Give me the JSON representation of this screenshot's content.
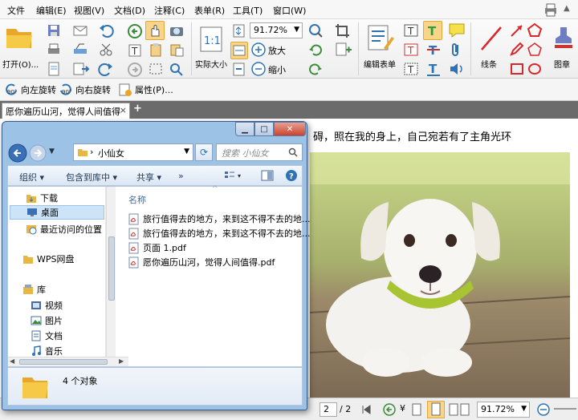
{
  "menu": [
    "文件",
    "编辑(E)",
    "视图(V)",
    "文档(D)",
    "注释(C)",
    "表单(R)",
    "工具(T)",
    "窗口(W)"
  ],
  "ribbon": {
    "open_label": "打开(O)...",
    "actual_size_label": "实际大小",
    "zoom_value": "91.72%",
    "zoom_in_label": "放大",
    "zoom_out_label": "缩小",
    "edit_form_label": "编辑表单",
    "lines_label": "线条",
    "shapes_label": "图章"
  },
  "subbar": {
    "rotate_left": "向左旋转",
    "rotate_right": "向右旋转",
    "properties": "属性(P)..."
  },
  "doc_tab": {
    "title": "愿你遍历山河，觉得人间值得",
    "close": "×",
    "add": "+"
  },
  "doc_text": "碍，照在我的身上，自己宛若有了主角光环",
  "explorer": {
    "address": "小仙女",
    "search_placeholder": "搜索 小仙女",
    "commands": [
      "组织 ▾",
      "包含到库中 ▾",
      "共享 ▾",
      "»"
    ],
    "nav_items": [
      "下载",
      "桌面",
      "最近访问的位置",
      "WPS网盘",
      "库",
      "视频",
      "图片",
      "文档",
      "音乐"
    ],
    "column_header": "名称",
    "files": [
      "旅行值得去的地方，来到这不得不去的地...",
      "旅行值得去的地方，来到这不得不去的地...",
      "页面 1.pdf",
      "愿你遍历山河，觉得人间值得.pdf"
    ],
    "status_count": "4 个对象"
  },
  "statusbar": {
    "page_current": "2",
    "page_total": "/ 2",
    "zoom_value": "91.72%"
  },
  "colors": {
    "explorer_frame": "#9cc3e6",
    "tab_bar": "#6b6b6b",
    "selected_nav": "#cde3f7",
    "pdf_accent": "#2e74b5"
  }
}
